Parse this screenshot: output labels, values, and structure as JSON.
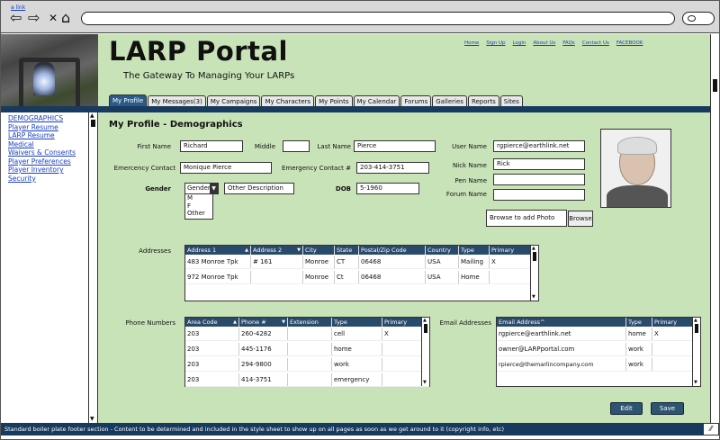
{
  "browser": {
    "link": "a link",
    "back": "⇦",
    "forward": "⇨",
    "close": "✕",
    "home": "⌂"
  },
  "header": {
    "title": "LARP Portal",
    "subtitle": "The Gateway To Managing Your LARPs",
    "links": [
      "Home",
      "Sign Up",
      "Login",
      "About Us",
      "FAQs",
      "Contact Us",
      "FACEBOOK"
    ]
  },
  "tabs": [
    "My Profile",
    "My Messages(3)",
    "My Campaigns",
    "My Characters",
    "My Points",
    "My Calendar",
    "Forums",
    "Galleries",
    "Reports",
    "Sites"
  ],
  "sidebar": {
    "items": [
      "DEMOGRAPHICS",
      "Player Resume",
      "LARP Resume",
      "Medical",
      "Waivers & Consents",
      "Player Preferences",
      "Player Inventory",
      "Security"
    ]
  },
  "page": {
    "heading": "My Profile - Demographics"
  },
  "form": {
    "first_name_label": "First Name",
    "first_name": "Richard",
    "middle_label": "Middle",
    "middle": "",
    "last_name_label": "Last Name",
    "last_name": "Pierce",
    "user_name_label": "User Name",
    "user_name": "rgpierce@earthlink.net",
    "emergency_contact_label": "Emercency Contact",
    "emergency_contact": "Monique Pierce",
    "emergency_contact_num_label": "Emergency Contact #",
    "emergency_contact_num": "203-414-3751",
    "nick_name_label": "Nick Name",
    "nick_name": "Rick",
    "gender_label": "Gender",
    "gender_value": "Gender",
    "gender_options": [
      "M",
      "F",
      "Other"
    ],
    "other_description": "Other Description",
    "dob_label": "DOB",
    "dob": "5-1960",
    "pen_name_label": "Pen Name",
    "pen_name": "",
    "forum_name_label": "Forum Name",
    "forum_name": "",
    "browse_placeholder": "Browse to add Photo",
    "browse_button": "Browse"
  },
  "addresses": {
    "label": "Addresses",
    "columns": [
      "Address 1",
      "Address 2",
      "City",
      "State",
      "Postal/Zip Code",
      "Country",
      "Type",
      "Primary"
    ],
    "rows": [
      [
        "483 Monroe Tpk",
        "# 161",
        "Monroe",
        "CT",
        "06468",
        "USA",
        "Mailing",
        "X"
      ],
      [
        "972 Monroe Tpk",
        "",
        "Monroe",
        "Ct",
        "06468",
        "USA",
        "Home",
        ""
      ]
    ]
  },
  "phones": {
    "label": "Phone Numbers",
    "columns": [
      "Area Code",
      "Phone #",
      "Extension",
      "Type",
      "Primary"
    ],
    "rows": [
      [
        "203",
        "260-4282",
        "",
        "cell",
        "X"
      ],
      [
        "203",
        "445-1176",
        "",
        "home",
        ""
      ],
      [
        "203",
        "294-9800",
        "",
        "work",
        ""
      ],
      [
        "203",
        "414-3751",
        "",
        "emergency",
        ""
      ]
    ]
  },
  "emails": {
    "label": "Email Addresses",
    "columns": [
      "Email Address^",
      "Type",
      "Primary"
    ],
    "rows": [
      [
        "rgpierce@earthlink.net",
        "home",
        "X"
      ],
      [
        "owner@LARPportal.com",
        "work",
        ""
      ],
      [
        "rpierce@themarlincompany.com",
        "work",
        ""
      ]
    ]
  },
  "actions": {
    "edit": "Edit",
    "save": "Save"
  },
  "footer": {
    "text": "Standard boiler plate footer section - Content to be determined and included in the style sheet to show up on all pages as soon as we get around to it (copyright info, etc)"
  },
  "colors": {
    "page_bg": "#c9e3b8",
    "nav_bar": "#173a5e",
    "grid_header": "#2a4a6b",
    "link": "#1a3fbf",
    "button": "#2d5470"
  }
}
